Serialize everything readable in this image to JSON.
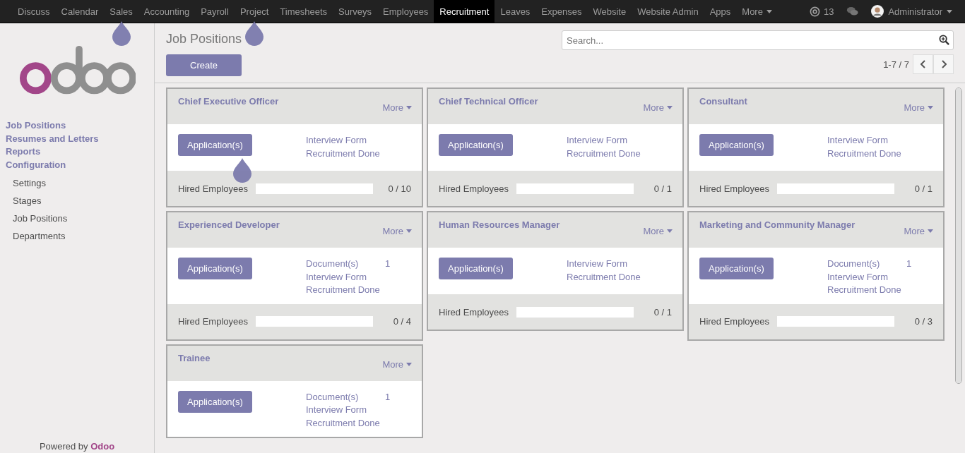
{
  "top_nav": {
    "items": [
      {
        "label": "Discuss",
        "selected": false,
        "tip": false
      },
      {
        "label": "Calendar",
        "selected": false,
        "tip": false
      },
      {
        "label": "Sales",
        "selected": false,
        "tip": true
      },
      {
        "label": "Accounting",
        "selected": false,
        "tip": false
      },
      {
        "label": "Payroll",
        "selected": false,
        "tip": false
      },
      {
        "label": "Project",
        "selected": false,
        "tip": true
      },
      {
        "label": "Timesheets",
        "selected": false,
        "tip": false
      },
      {
        "label": "Surveys",
        "selected": false,
        "tip": false
      },
      {
        "label": "Employees",
        "selected": false,
        "tip": false
      },
      {
        "label": "Recruitment",
        "selected": true,
        "tip": false
      },
      {
        "label": "Leaves",
        "selected": false,
        "tip": false
      },
      {
        "label": "Expenses",
        "selected": false,
        "tip": false
      },
      {
        "label": "Website",
        "selected": false,
        "tip": false
      },
      {
        "label": "Website Admin",
        "selected": false,
        "tip": false
      },
      {
        "label": "Apps",
        "selected": false,
        "tip": false
      }
    ],
    "more": "More",
    "mentions": "13",
    "user": "Administrator"
  },
  "sidebar": {
    "sections": [
      {
        "label": "Job Positions"
      },
      {
        "label": "Resumes and Letters"
      },
      {
        "label": "Reports"
      },
      {
        "label": "Configuration",
        "children": [
          {
            "label": "Settings"
          },
          {
            "label": "Stages"
          },
          {
            "label": "Job Positions"
          },
          {
            "label": "Departments"
          }
        ]
      }
    ],
    "footer_text": "Powered by",
    "footer_brand": "Odoo"
  },
  "control_panel": {
    "title": "Job Positions",
    "create_button": "Create",
    "search": {
      "placeholder": "Search..."
    },
    "pager": "1-7 / 7"
  },
  "cards": [
    {
      "title": "Chief Executive Officer",
      "more": "More",
      "button": "Application(s)",
      "tip": true,
      "links": [
        {
          "label": "Interview Form"
        },
        {
          "label": "Recruitment Done"
        }
      ],
      "footer": {
        "label": "Hired Employees",
        "level": 0,
        "reading": "0 / 10"
      }
    },
    {
      "title": "Chief Technical Officer",
      "more": "More",
      "button": "Application(s)",
      "tip": false,
      "links": [
        {
          "label": "Interview Form"
        },
        {
          "label": "Recruitment Done"
        }
      ],
      "footer": {
        "label": "Hired Employees",
        "level": 0,
        "reading": "0 / 1"
      }
    },
    {
      "title": "Consultant",
      "more": "More",
      "button": "Application(s)",
      "tip": false,
      "links": [
        {
          "label": "Interview Form"
        },
        {
          "label": "Recruitment Done"
        }
      ],
      "footer": {
        "label": "Hired Employees",
        "level": 0,
        "reading": "0 / 1"
      }
    },
    {
      "title": "Experienced Developer",
      "more": "More",
      "button": "Application(s)",
      "tip": false,
      "links": [
        {
          "label": "Document(s)",
          "count": "1"
        },
        {
          "label": "Interview Form"
        },
        {
          "label": "Recruitment Done"
        }
      ],
      "footer": {
        "label": "Hired Employees",
        "level": 0,
        "reading": "0 / 4"
      }
    },
    {
      "title": "Human Resources Manager",
      "more": "More",
      "button": "Application(s)",
      "tip": false,
      "links": [
        {
          "label": "Interview Form"
        },
        {
          "label": "Recruitment Done"
        }
      ],
      "footer": {
        "label": "Hired Employees",
        "level": 0,
        "reading": "0 / 1"
      }
    },
    {
      "title": "Marketing and Community Manager",
      "more": "More",
      "button": "Application(s)",
      "tip": false,
      "links": [
        {
          "label": "Document(s)",
          "count": "1"
        },
        {
          "label": "Interview Form"
        },
        {
          "label": "Recruitment Done"
        }
      ],
      "footer": {
        "label": "Hired Employees",
        "level": 0,
        "reading": "0 / 3"
      }
    },
    {
      "title": "Trainee",
      "more": "More",
      "button": "Application(s)",
      "tip": false,
      "links": [
        {
          "label": "Document(s)",
          "count": "1"
        },
        {
          "label": "Interview Form"
        },
        {
          "label": "Recruitment Done"
        }
      ]
    }
  ]
}
